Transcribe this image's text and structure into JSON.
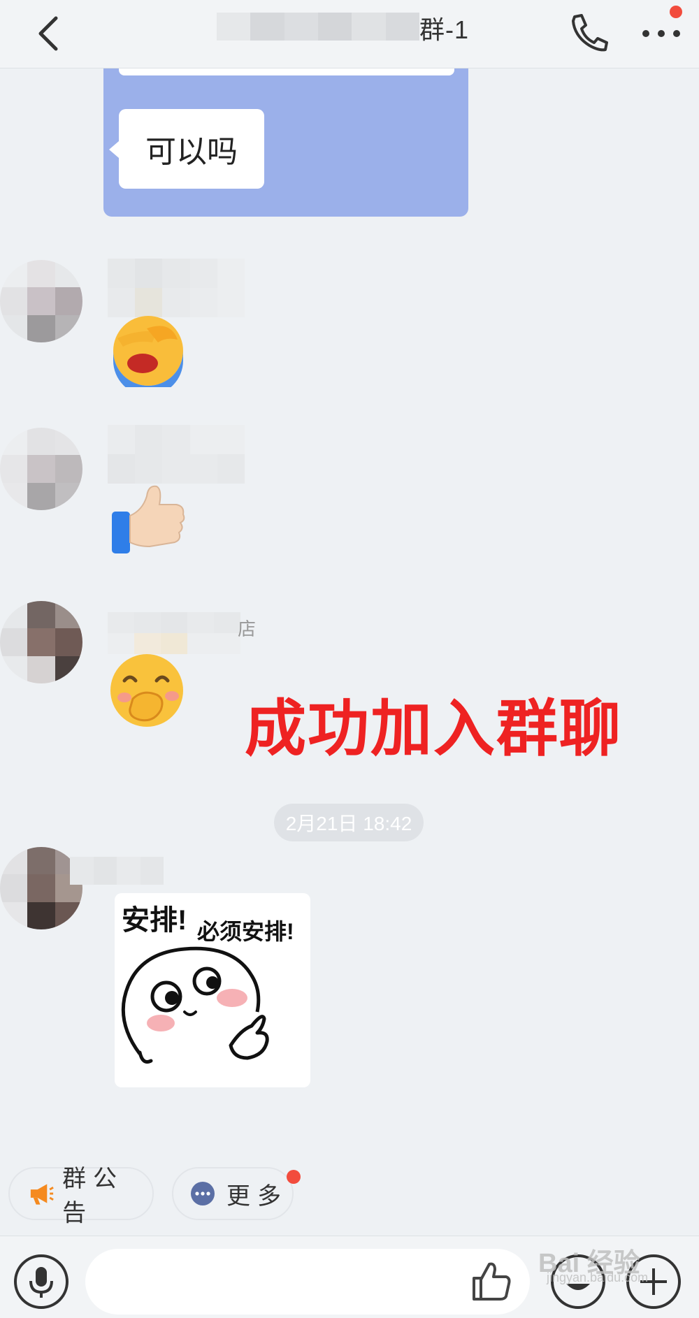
{
  "header": {
    "title": "群-1"
  },
  "forwarded_message": {
    "text": "可以吗"
  },
  "messages": [
    {
      "sender": "",
      "content_icon": "face-palm-crying-emoji"
    },
    {
      "sender": "",
      "content_icon": "thumbs-up-emoji"
    },
    {
      "sender": "",
      "sender_suffix": "店",
      "content_icon": "smiling-hand-over-mouth-emoji"
    }
  ],
  "annotation": {
    "text": "成功加入群聊",
    "color": "#ee2222"
  },
  "timestamp": "2月21日 18:42",
  "sticker": {
    "line1": "安排!",
    "line2": "必须安排!"
  },
  "quick_actions": {
    "announcement_label": "群公告",
    "more_label": "更多"
  },
  "watermark": {
    "text": "Bai 经验",
    "sub": "jingyan.baidu.com"
  },
  "colors": {
    "accent_red": "#f24c3d",
    "forward_card": "#9bb0ea",
    "announcement_icon": "#f58a1f",
    "more_icon": "#5b6fa5"
  }
}
